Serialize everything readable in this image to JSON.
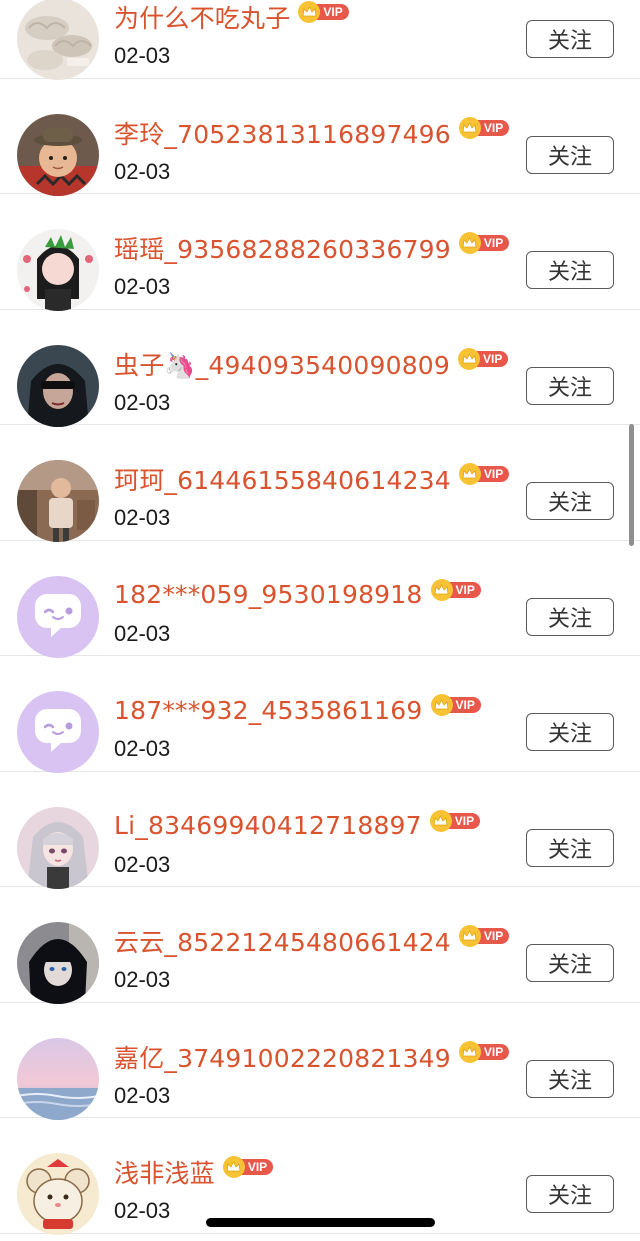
{
  "follow_label": "关注",
  "vip_label": "VIP",
  "colors": {
    "name": "#d9532e",
    "vip_badge": "#e8584a",
    "vip_crown": "#f7c233",
    "default_avatar": "#d8c3f3"
  },
  "users": [
    {
      "name": "为什么不吃丸子",
      "date": "02-03",
      "avatar": "photo-dumplings"
    },
    {
      "name": "李玲_7052381311 6897496",
      "date": "02-03",
      "avatar": "photo-child-hat"
    },
    {
      "name": "瑶瑶_93568288260336799",
      "date": "02-03",
      "avatar": "photo-girl-plant"
    },
    {
      "name": "虫子🦄_494093540090809",
      "date": "02-03",
      "avatar": "photo-person-dark"
    },
    {
      "name": "珂珂_61446155840614234",
      "date": "02-03",
      "avatar": "photo-child-outdoor"
    },
    {
      "name": "182***059_9530198918",
      "date": "02-03",
      "avatar": "default-chat-icon"
    },
    {
      "name": "187***932_4535861169",
      "date": "02-03",
      "avatar": "default-chat-icon"
    },
    {
      "name": "Li_83469940412718897",
      "date": "02-03",
      "avatar": "anime-girl"
    },
    {
      "name": "云云_85221245480661424",
      "date": "02-03",
      "avatar": "anime-boy"
    },
    {
      "name": "嘉亿_37491002220821349",
      "date": "02-03",
      "avatar": "sunset-sea"
    },
    {
      "name": "浅非浅蓝",
      "date": "02-03",
      "avatar": "cartoon-mouse"
    }
  ]
}
